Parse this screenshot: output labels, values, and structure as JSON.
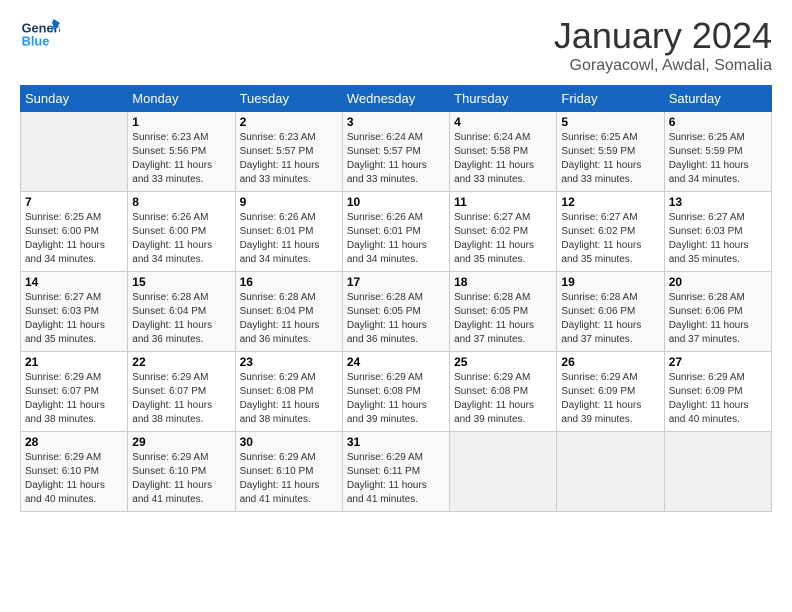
{
  "header": {
    "logo": {
      "line1": "General",
      "line2": "Blue"
    },
    "title": "January 2024",
    "subtitle": "Gorayacowl, Awdal, Somalia"
  },
  "calendar": {
    "days_of_week": [
      "Sunday",
      "Monday",
      "Tuesday",
      "Wednesday",
      "Thursday",
      "Friday",
      "Saturday"
    ],
    "weeks": [
      [
        {
          "day": "",
          "sunrise": "",
          "sunset": "",
          "daylight": "",
          "empty": true
        },
        {
          "day": "1",
          "sunrise": "Sunrise: 6:23 AM",
          "sunset": "Sunset: 5:56 PM",
          "daylight": "Daylight: 11 hours and 33 minutes."
        },
        {
          "day": "2",
          "sunrise": "Sunrise: 6:23 AM",
          "sunset": "Sunset: 5:57 PM",
          "daylight": "Daylight: 11 hours and 33 minutes."
        },
        {
          "day": "3",
          "sunrise": "Sunrise: 6:24 AM",
          "sunset": "Sunset: 5:57 PM",
          "daylight": "Daylight: 11 hours and 33 minutes."
        },
        {
          "day": "4",
          "sunrise": "Sunrise: 6:24 AM",
          "sunset": "Sunset: 5:58 PM",
          "daylight": "Daylight: 11 hours and 33 minutes."
        },
        {
          "day": "5",
          "sunrise": "Sunrise: 6:25 AM",
          "sunset": "Sunset: 5:59 PM",
          "daylight": "Daylight: 11 hours and 33 minutes."
        },
        {
          "day": "6",
          "sunrise": "Sunrise: 6:25 AM",
          "sunset": "Sunset: 5:59 PM",
          "daylight": "Daylight: 11 hours and 34 minutes."
        }
      ],
      [
        {
          "day": "7",
          "sunrise": "Sunrise: 6:25 AM",
          "sunset": "Sunset: 6:00 PM",
          "daylight": "Daylight: 11 hours and 34 minutes."
        },
        {
          "day": "8",
          "sunrise": "Sunrise: 6:26 AM",
          "sunset": "Sunset: 6:00 PM",
          "daylight": "Daylight: 11 hours and 34 minutes."
        },
        {
          "day": "9",
          "sunrise": "Sunrise: 6:26 AM",
          "sunset": "Sunset: 6:01 PM",
          "daylight": "Daylight: 11 hours and 34 minutes."
        },
        {
          "day": "10",
          "sunrise": "Sunrise: 6:26 AM",
          "sunset": "Sunset: 6:01 PM",
          "daylight": "Daylight: 11 hours and 34 minutes."
        },
        {
          "day": "11",
          "sunrise": "Sunrise: 6:27 AM",
          "sunset": "Sunset: 6:02 PM",
          "daylight": "Daylight: 11 hours and 35 minutes."
        },
        {
          "day": "12",
          "sunrise": "Sunrise: 6:27 AM",
          "sunset": "Sunset: 6:02 PM",
          "daylight": "Daylight: 11 hours and 35 minutes."
        },
        {
          "day": "13",
          "sunrise": "Sunrise: 6:27 AM",
          "sunset": "Sunset: 6:03 PM",
          "daylight": "Daylight: 11 hours and 35 minutes."
        }
      ],
      [
        {
          "day": "14",
          "sunrise": "Sunrise: 6:27 AM",
          "sunset": "Sunset: 6:03 PM",
          "daylight": "Daylight: 11 hours and 35 minutes."
        },
        {
          "day": "15",
          "sunrise": "Sunrise: 6:28 AM",
          "sunset": "Sunset: 6:04 PM",
          "daylight": "Daylight: 11 hours and 36 minutes."
        },
        {
          "day": "16",
          "sunrise": "Sunrise: 6:28 AM",
          "sunset": "Sunset: 6:04 PM",
          "daylight": "Daylight: 11 hours and 36 minutes."
        },
        {
          "day": "17",
          "sunrise": "Sunrise: 6:28 AM",
          "sunset": "Sunset: 6:05 PM",
          "daylight": "Daylight: 11 hours and 36 minutes."
        },
        {
          "day": "18",
          "sunrise": "Sunrise: 6:28 AM",
          "sunset": "Sunset: 6:05 PM",
          "daylight": "Daylight: 11 hours and 37 minutes."
        },
        {
          "day": "19",
          "sunrise": "Sunrise: 6:28 AM",
          "sunset": "Sunset: 6:06 PM",
          "daylight": "Daylight: 11 hours and 37 minutes."
        },
        {
          "day": "20",
          "sunrise": "Sunrise: 6:28 AM",
          "sunset": "Sunset: 6:06 PM",
          "daylight": "Daylight: 11 hours and 37 minutes."
        }
      ],
      [
        {
          "day": "21",
          "sunrise": "Sunrise: 6:29 AM",
          "sunset": "Sunset: 6:07 PM",
          "daylight": "Daylight: 11 hours and 38 minutes."
        },
        {
          "day": "22",
          "sunrise": "Sunrise: 6:29 AM",
          "sunset": "Sunset: 6:07 PM",
          "daylight": "Daylight: 11 hours and 38 minutes."
        },
        {
          "day": "23",
          "sunrise": "Sunrise: 6:29 AM",
          "sunset": "Sunset: 6:08 PM",
          "daylight": "Daylight: 11 hours and 38 minutes."
        },
        {
          "day": "24",
          "sunrise": "Sunrise: 6:29 AM",
          "sunset": "Sunset: 6:08 PM",
          "daylight": "Daylight: 11 hours and 39 minutes."
        },
        {
          "day": "25",
          "sunrise": "Sunrise: 6:29 AM",
          "sunset": "Sunset: 6:08 PM",
          "daylight": "Daylight: 11 hours and 39 minutes."
        },
        {
          "day": "26",
          "sunrise": "Sunrise: 6:29 AM",
          "sunset": "Sunset: 6:09 PM",
          "daylight": "Daylight: 11 hours and 39 minutes."
        },
        {
          "day": "27",
          "sunrise": "Sunrise: 6:29 AM",
          "sunset": "Sunset: 6:09 PM",
          "daylight": "Daylight: 11 hours and 40 minutes."
        }
      ],
      [
        {
          "day": "28",
          "sunrise": "Sunrise: 6:29 AM",
          "sunset": "Sunset: 6:10 PM",
          "daylight": "Daylight: 11 hours and 40 minutes."
        },
        {
          "day": "29",
          "sunrise": "Sunrise: 6:29 AM",
          "sunset": "Sunset: 6:10 PM",
          "daylight": "Daylight: 11 hours and 41 minutes."
        },
        {
          "day": "30",
          "sunrise": "Sunrise: 6:29 AM",
          "sunset": "Sunset: 6:10 PM",
          "daylight": "Daylight: 11 hours and 41 minutes."
        },
        {
          "day": "31",
          "sunrise": "Sunrise: 6:29 AM",
          "sunset": "Sunset: 6:11 PM",
          "daylight": "Daylight: 11 hours and 41 minutes."
        },
        {
          "day": "",
          "sunrise": "",
          "sunset": "",
          "daylight": "",
          "empty": true
        },
        {
          "day": "",
          "sunrise": "",
          "sunset": "",
          "daylight": "",
          "empty": true
        },
        {
          "day": "",
          "sunrise": "",
          "sunset": "",
          "daylight": "",
          "empty": true
        }
      ]
    ]
  }
}
